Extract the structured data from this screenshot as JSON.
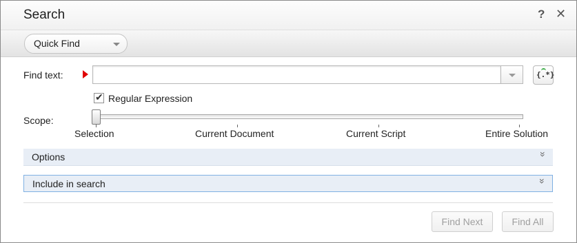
{
  "window": {
    "title": "Search",
    "help_label": "?",
    "close_label": "✕"
  },
  "toolbar": {
    "mode_selected": "Quick Find"
  },
  "find": {
    "label": "Find text:",
    "value": "",
    "placeholder": "",
    "regex_button_glyph": "{.*}"
  },
  "regex": {
    "label": "Regular Expression",
    "checked": true,
    "check_glyph": "✔"
  },
  "scope": {
    "label": "Scope:",
    "options": [
      "Selection",
      "Current Document",
      "Current Script",
      "Entire Solution"
    ],
    "selected_index": 0
  },
  "panels": {
    "options_label": "Options",
    "include_label": "Include in search",
    "chevron_glyph": "»"
  },
  "buttons": {
    "find_next": "Find Next",
    "find_all": "Find All"
  },
  "colors": {
    "required_marker": "#e00000",
    "panel_background": "#e8eef6",
    "panel_focus_border": "#7fb0e3",
    "disabled_text": "#9f9f9f"
  },
  "icons": [
    "help-icon",
    "close-icon",
    "chevron-down-icon",
    "required-marker-icon",
    "regex-builder-icon",
    "checkmark-icon",
    "double-chevron-down-icon"
  ]
}
